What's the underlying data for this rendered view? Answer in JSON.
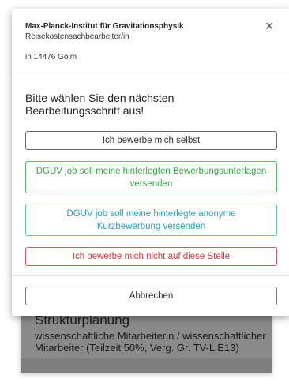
{
  "modal": {
    "employer": "Max-Planck-Institut für Gravitationsphysik",
    "role": "Reisekostensachbearbeiter/in",
    "location": "in 14476 Golm",
    "close_glyph": "×",
    "prompt": "Bitte wählen Sie den nächsten Bearbeitungsschritt aus!",
    "options": {
      "self": "Ich bewerbe mich selbst",
      "send_documents": "DGUV job soll meine hinterlegten Bewerbungsunterlagen versenden",
      "send_anonymous": "DGUV job soll meine hinterlegte anonyme Kurzbewerbung versenden",
      "decline": "Ich bewerbe mich nicht auf diese Stelle"
    },
    "cancel": "Abbrechen"
  },
  "background": {
    "title": "Strukturplanung",
    "subtitle": "wissenschaftliche Mitarbeiterin / wissenschaftlicher Mitarbeiter (Teilzeit 50%, Verg. Gr. TV-L E13)"
  },
  "colors": {
    "overlay": "#8a8a8a",
    "green": "#3aa447",
    "blue": "#2a9fc0",
    "red": "#d63a40"
  }
}
